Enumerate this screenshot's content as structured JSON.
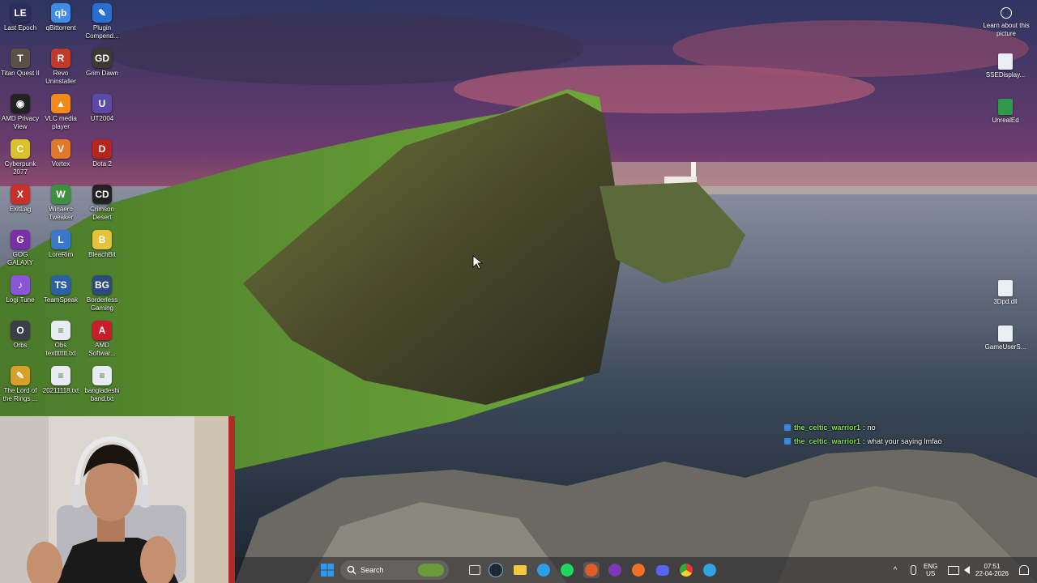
{
  "desktop": {
    "left_icons": [
      {
        "label": "Last Epoch",
        "icon": "last-epoch-icon",
        "color": "#2b2e5c",
        "glyph": "LE"
      },
      {
        "label": "qBittorrent",
        "icon": "qbittorrent-icon",
        "color": "#3f8ce6",
        "glyph": "qb"
      },
      {
        "label": "Plugin Compend...",
        "icon": "plugin-icon",
        "color": "#2a6fd0",
        "glyph": "✎"
      },
      {
        "label": "Titan Quest II",
        "icon": "titan-quest-icon",
        "color": "#5a5046",
        "glyph": "T"
      },
      {
        "label": "Revo Uninstaller",
        "icon": "revo-icon",
        "color": "#c0392b",
        "glyph": "R"
      },
      {
        "label": "Grim Dawn",
        "icon": "grim-dawn-icon",
        "color": "#3d3a33",
        "glyph": "GD"
      },
      {
        "label": "AMD Privacy View",
        "icon": "amd-privacy-icon",
        "color": "#222222",
        "glyph": "◉"
      },
      {
        "label": "VLC media player",
        "icon": "vlc-icon",
        "color": "#f28a1a",
        "glyph": "▲"
      },
      {
        "label": "UT2004",
        "icon": "ut2004-icon",
        "color": "#5b4aa8",
        "glyph": "U"
      },
      {
        "label": "Cyberpunk 2077",
        "icon": "cyberpunk-icon",
        "color": "#d8c12a",
        "glyph": "C"
      },
      {
        "label": "Vortex",
        "icon": "vortex-icon",
        "color": "#e07a2a",
        "glyph": "V"
      },
      {
        "label": "Dota 2",
        "icon": "dota-icon",
        "color": "#b3251d",
        "glyph": "D"
      },
      {
        "label": "ExitLag",
        "icon": "exitlag-icon",
        "color": "#c8302a",
        "glyph": "X"
      },
      {
        "label": "Winaero Tweaker",
        "icon": "winaero-icon",
        "color": "#3e8f3e",
        "glyph": "W"
      },
      {
        "label": "Crimson Desert",
        "icon": "crimson-desert-icon",
        "color": "#222222",
        "glyph": "CD"
      },
      {
        "label": "GOG GALAXY",
        "icon": "gog-icon",
        "color": "#7a2ea8",
        "glyph": "G"
      },
      {
        "label": "LoreRim",
        "icon": "lorerim-icon",
        "color": "#3a78c8",
        "glyph": "L"
      },
      {
        "label": "BleachBit",
        "icon": "bleachbit-icon",
        "color": "#e4c23a",
        "glyph": "B"
      },
      {
        "label": "Logi Tune",
        "icon": "logi-tune-icon",
        "color": "#8a55d8",
        "glyph": "♪"
      },
      {
        "label": "TeamSpeak",
        "icon": "teamspeak-icon",
        "color": "#2b5fa8",
        "glyph": "TS"
      },
      {
        "label": "Borderless Gaming",
        "icon": "borderless-icon",
        "color": "#2d4a7a",
        "glyph": "BG"
      },
      {
        "label": "Orbs",
        "icon": "orbs-icon",
        "color": "#3a3f48",
        "glyph": "O"
      },
      {
        "label": "Obs texttttttt.txt",
        "icon": "text-file-icon",
        "color": "#e8ecf2",
        "glyph": "≡"
      },
      {
        "label": "AMD Softwar...",
        "icon": "amd-software-icon",
        "color": "#c81e2a",
        "glyph": "A"
      },
      {
        "label": "The Lord of the Rings ...",
        "icon": "lotr-icon",
        "color": "#d8a02a",
        "glyph": "✎"
      },
      {
        "label": "20211118.txt",
        "icon": "text-file-icon",
        "color": "#e8ecf2",
        "glyph": "≡"
      },
      {
        "label": "bangladeshi band.txt",
        "icon": "text-file-icon",
        "color": "#e8ecf2",
        "glyph": "≡"
      }
    ],
    "right_icons": [
      {
        "label": "SSEDisplay...",
        "icon": "file-icon"
      },
      {
        "label": "UnrealEd",
        "icon": "unrealed-icon"
      },
      {
        "label": "3Dpd.dll",
        "icon": "dll-file-icon"
      },
      {
        "label": "GameUserS...",
        "icon": "file-icon"
      }
    ],
    "learn_about": "Learn about this picture"
  },
  "chat": {
    "messages": [
      {
        "user": "the_celtic_warrior1",
        "text": "no"
      },
      {
        "user": "the_celtic_warrior1",
        "text": "what your saying lmfao"
      }
    ]
  },
  "taskbar": {
    "search_label": "Search",
    "language_line1": "ENG",
    "language_line2": "US",
    "time": "07:51",
    "date": "22-04-2026",
    "apps": [
      "start-icon",
      "search-icon",
      "widgets-icon",
      "task-view-icon",
      "steam-icon",
      "file-explorer-icon",
      "edge-icon",
      "spotify-icon",
      "app-icon",
      "obs-icon",
      "firefox-icon",
      "discord-icon",
      "chrome-icon",
      "telegram-icon"
    ]
  }
}
